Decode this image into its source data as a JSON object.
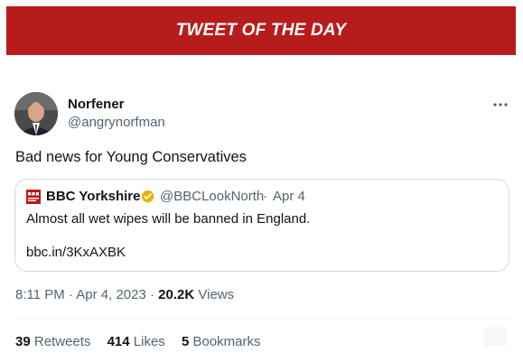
{
  "banner": {
    "title": "TWEET OF THE DAY"
  },
  "tweet": {
    "author": {
      "name": "Norfener",
      "handle": "@angrynorfman"
    },
    "text": "Bad news for Young Conservatives",
    "quoted": {
      "source_name": "BBC Yorkshire",
      "handle": "@BBCLookNorth",
      "separator": "·",
      "date": "Apr 4",
      "text": "Almost all wet wipes will be banned in England.",
      "link": "bbc.in/3KxAXBK"
    },
    "time": "8:11 PM",
    "date": "Apr 4, 2023",
    "views_count": "20.2K",
    "views_label": "Views",
    "stats": {
      "retweets_count": "39",
      "retweets_label": "Retweets",
      "likes_count": "414",
      "likes_label": "Likes",
      "bookmarks_count": "5",
      "bookmarks_label": "Bookmarks"
    }
  },
  "colors": {
    "banner": "#b71c1c",
    "muted": "#536471",
    "border": "#cfd9de",
    "verified": "#e8b20a",
    "bbc": "#bb1919"
  },
  "icons": {
    "more": "more-icon",
    "verified": "verified-icon",
    "avatar": "avatar",
    "bbc_logo": "bbc-logo-icon"
  }
}
